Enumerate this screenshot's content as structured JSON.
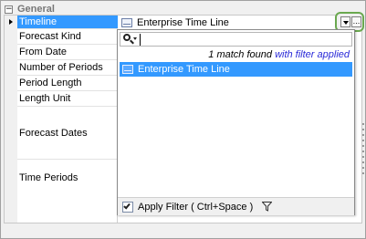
{
  "section": {
    "title": "General",
    "expander": "−"
  },
  "properties": [
    {
      "label": "Timeline",
      "selected": true
    },
    {
      "label": "Forecast Kind"
    },
    {
      "label": "From Date"
    },
    {
      "label": "Number of Periods"
    },
    {
      "label": "Period Length"
    },
    {
      "label": "Length Unit"
    },
    {
      "label": "Forecast Dates"
    },
    {
      "label": "Time Periods"
    }
  ],
  "value": {
    "text": "Enterprise Time Line",
    "icon": "timeline-entity-icon"
  },
  "buttons": {
    "more_label": "...",
    "dropdown_icon": "chevron-down-icon"
  },
  "popup": {
    "search": {
      "value": "",
      "placeholder": "",
      "icon": "search-icon"
    },
    "match_count_text": "1 match found",
    "filter_applied_text": "with filter applied",
    "results": [
      {
        "text": "Enterprise Time Line",
        "selected": true
      }
    ],
    "apply_filter": {
      "label": "Apply Filter ( Ctrl+Space )",
      "checked": true
    },
    "filter_icon": "funnel-icon"
  },
  "colors": {
    "selection": "#3399ff",
    "highlight_ring": "#6aa84f",
    "info_link": "#2a2ad8"
  }
}
